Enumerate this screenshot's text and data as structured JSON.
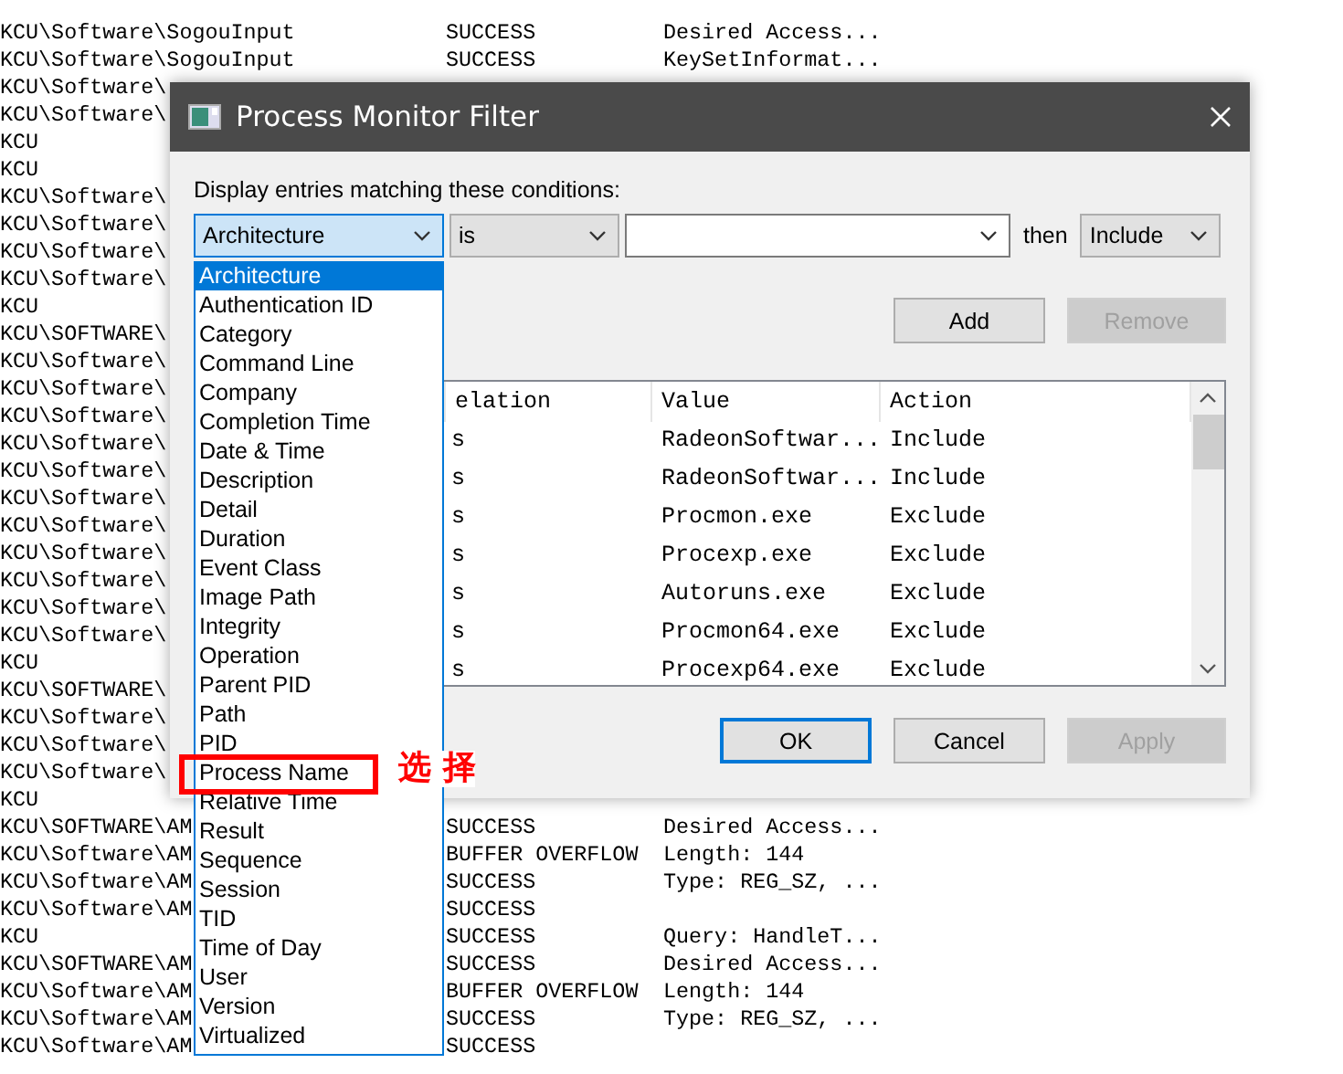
{
  "log": {
    "rows": [
      {
        "path": "KCU\\Software\\SogouInput",
        "result": "SUCCESS",
        "detail": "Desired Access..."
      },
      {
        "path": "KCU\\Software\\SogouInput",
        "result": "SUCCESS",
        "detail": "KeySetInformat..."
      },
      {
        "path": "KCU\\Software\\"
      },
      {
        "path": "KCU\\Software\\"
      },
      {
        "path": "KCU"
      },
      {
        "path": "KCU"
      },
      {
        "path": "KCU\\Software\\"
      },
      {
        "path": "KCU\\Software\\"
      },
      {
        "path": "KCU\\Software\\"
      },
      {
        "path": "KCU\\Software\\"
      },
      {
        "path": "KCU"
      },
      {
        "path": "KCU\\SOFTWARE\\"
      },
      {
        "path": "KCU\\Software\\"
      },
      {
        "path": "KCU\\Software\\"
      },
      {
        "path": "KCU\\Software\\"
      },
      {
        "path": "KCU\\Software\\"
      },
      {
        "path": "KCU\\Software\\"
      },
      {
        "path": "KCU\\Software\\"
      },
      {
        "path": "KCU\\Software\\"
      },
      {
        "path": "KCU\\Software\\"
      },
      {
        "path": "KCU\\Software\\"
      },
      {
        "path": "KCU\\Software\\"
      },
      {
        "path": "KCU\\Software\\"
      },
      {
        "path": "KCU"
      },
      {
        "path": "KCU\\SOFTWARE\\"
      },
      {
        "path": "KCU\\Software\\"
      },
      {
        "path": "KCU\\Software\\"
      },
      {
        "path": "KCU\\Software\\"
      },
      {
        "path": "KCU"
      },
      {
        "path": "KCU\\SOFTWARE\\AM",
        "result": "SUCCESS",
        "detail": "Desired Access..."
      },
      {
        "path": "KCU\\Software\\AM",
        "result": "BUFFER OVERFLOW",
        "detail": "Length: 144"
      },
      {
        "path": "KCU\\Software\\AM",
        "result": "SUCCESS",
        "detail": "Type: REG_SZ, ..."
      },
      {
        "path": "KCU\\Software\\AM",
        "result": "SUCCESS"
      },
      {
        "path": "KCU",
        "result": "SUCCESS",
        "detail": "Query: HandleT..."
      },
      {
        "path": "KCU\\SOFTWARE\\AM",
        "result": "SUCCESS",
        "detail": "Desired Access..."
      },
      {
        "path": "KCU\\Software\\AM",
        "result": "BUFFER OVERFLOW",
        "detail": "Length: 144"
      },
      {
        "path": "KCU\\Software\\AM",
        "result": "SUCCESS",
        "detail": "Type: REG_SZ, ..."
      },
      {
        "path": "KCU\\Software\\AM",
        "result": "SUCCESS"
      }
    ]
  },
  "dialog": {
    "title": "Process Monitor Filter",
    "prompt": "Display entries matching these conditions:",
    "filter": {
      "column": "Architecture",
      "relation": "is",
      "then": "then",
      "action": "Include"
    },
    "add_button": {
      "label": "Add",
      "disabled": false
    },
    "remove_button": {
      "label": "Remove",
      "disabled": true
    },
    "table": {
      "columns": [
        "elation",
        "Value",
        "Action"
      ],
      "rows": [
        {
          "relation": "s",
          "value": "RadeonSoftwar...",
          "action": "Include"
        },
        {
          "relation": "s",
          "value": "RadeonSoftwar...",
          "action": "Include"
        },
        {
          "relation": "s",
          "value": "Procmon.exe",
          "action": "Exclude"
        },
        {
          "relation": "s",
          "value": "Procexp.exe",
          "action": "Exclude"
        },
        {
          "relation": "s",
          "value": "Autoruns.exe",
          "action": "Exclude"
        },
        {
          "relation": "s",
          "value": "Procmon64.exe",
          "action": "Exclude"
        },
        {
          "relation": "s",
          "value": "Procexp64.exe",
          "action": "Exclude"
        }
      ]
    },
    "buttons": [
      {
        "label": "OK",
        "default": true,
        "disabled": false
      },
      {
        "label": "Cancel",
        "default": false,
        "disabled": false
      },
      {
        "label": "Apply",
        "default": false,
        "disabled": true
      }
    ]
  },
  "dropdown": {
    "items": [
      {
        "label": "Architecture",
        "selected": true,
        "highlighted": false
      },
      {
        "label": "Authentication ID",
        "selected": false,
        "highlighted": false
      },
      {
        "label": "Category",
        "selected": false,
        "highlighted": false
      },
      {
        "label": "Command Line",
        "selected": false,
        "highlighted": false
      },
      {
        "label": "Company",
        "selected": false,
        "highlighted": false
      },
      {
        "label": "Completion Time",
        "selected": false,
        "highlighted": false
      },
      {
        "label": "Date & Time",
        "selected": false,
        "highlighted": false
      },
      {
        "label": "Description",
        "selected": false,
        "highlighted": false
      },
      {
        "label": "Detail",
        "selected": false,
        "highlighted": false
      },
      {
        "label": "Duration",
        "selected": false,
        "highlighted": false
      },
      {
        "label": "Event Class",
        "selected": false,
        "highlighted": false
      },
      {
        "label": "Image Path",
        "selected": false,
        "highlighted": false
      },
      {
        "label": "Integrity",
        "selected": false,
        "highlighted": false
      },
      {
        "label": "Operation",
        "selected": false,
        "highlighted": false
      },
      {
        "label": "Parent PID",
        "selected": false,
        "highlighted": false
      },
      {
        "label": "Path",
        "selected": false,
        "highlighted": false
      },
      {
        "label": "PID",
        "selected": false,
        "highlighted": false
      },
      {
        "label": "Process Name",
        "selected": false,
        "highlighted": true
      },
      {
        "label": "Relative Time",
        "selected": false,
        "highlighted": false
      },
      {
        "label": "Result",
        "selected": false,
        "highlighted": false
      },
      {
        "label": "Sequence",
        "selected": false,
        "highlighted": false
      },
      {
        "label": "Session",
        "selected": false,
        "highlighted": false
      },
      {
        "label": "TID",
        "selected": false,
        "highlighted": false
      },
      {
        "label": "Time of Day",
        "selected": false,
        "highlighted": false
      },
      {
        "label": "User",
        "selected": false,
        "highlighted": false
      },
      {
        "label": "Version",
        "selected": false,
        "highlighted": false
      },
      {
        "label": "Virtualized",
        "selected": false,
        "highlighted": false
      }
    ]
  },
  "annotation": {
    "text": "选 择"
  }
}
